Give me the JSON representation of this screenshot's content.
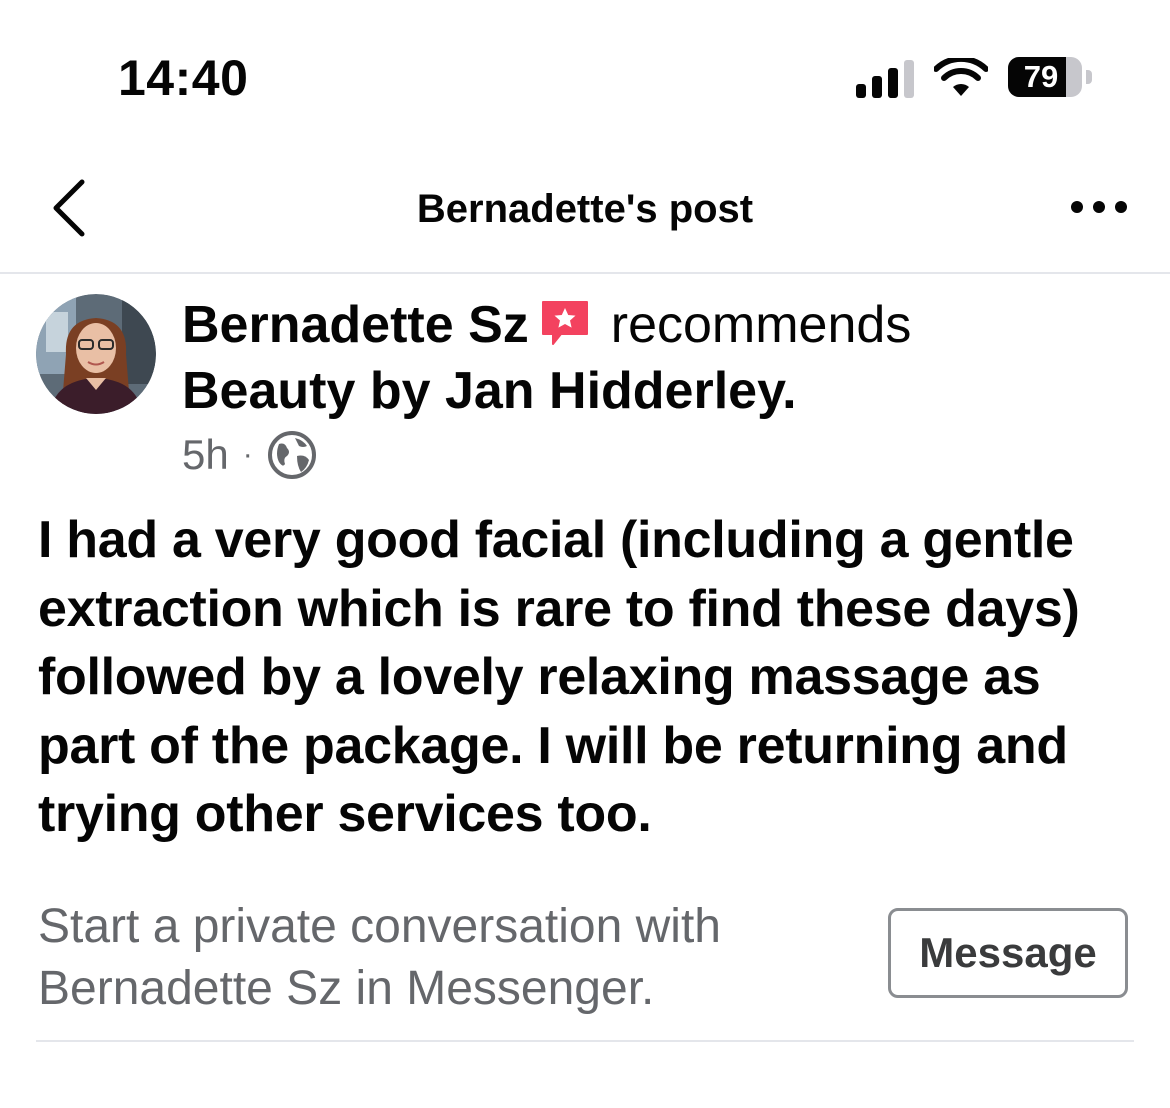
{
  "status_bar": {
    "time": "14:40",
    "signal_bars": 4,
    "signal_active": 3,
    "battery_percent": "79",
    "battery_level": 0.79
  },
  "header": {
    "title": "Bernadette's post",
    "back_icon": "chevron-left-icon",
    "more_icon": "more-horizontal-icon"
  },
  "post": {
    "author": "Bernadette Sz",
    "recommends": "recommends",
    "business": "Beauty by Jan Hidderley",
    "business_suffix": ".",
    "time_ago": "5h",
    "separator": "·",
    "audience_icon": "globe-icon",
    "body": "I had a very good facial (including a gentle extraction which is rare to find these days) followed by a lovely relaxing massage as part of the package. I will be returning and trying other services too.",
    "badge_color": "#f3425f"
  },
  "messenger": {
    "prompt": "Start a private conversation with Bernadette Sz in Messenger.",
    "button_label": "Message"
  }
}
